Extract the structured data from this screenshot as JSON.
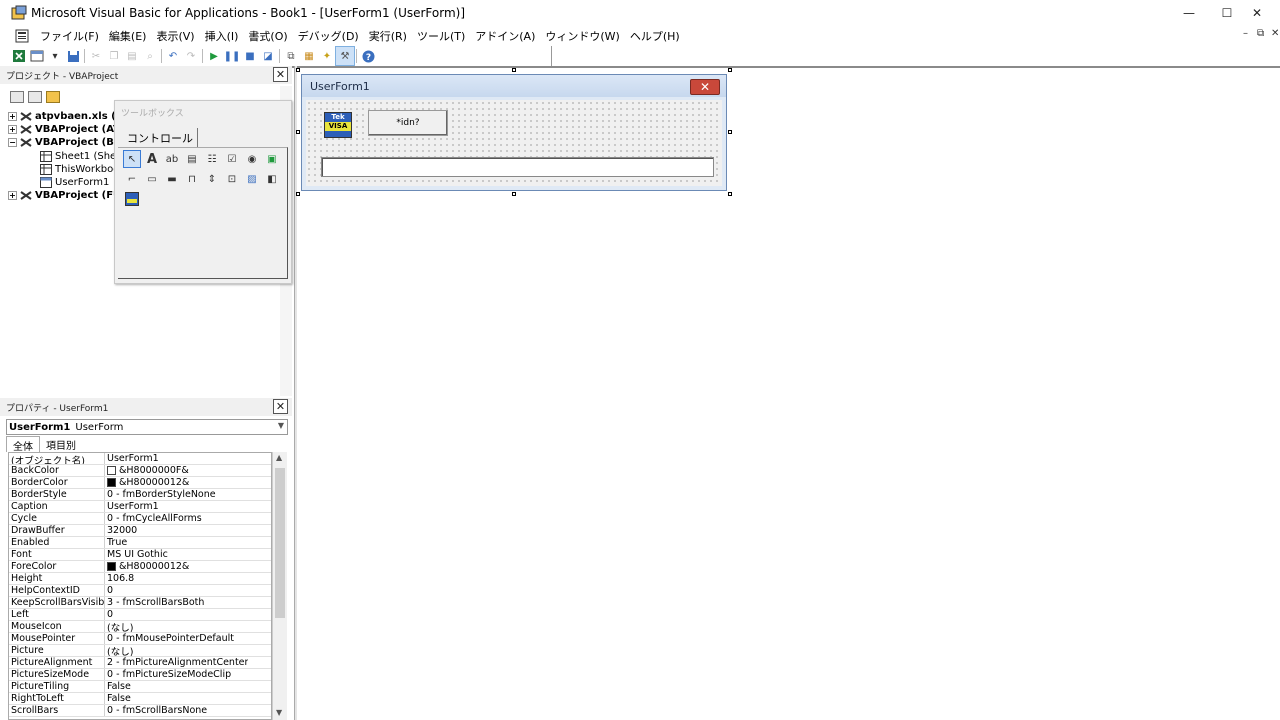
{
  "window": {
    "title": "Microsoft Visual Basic for Applications - Book1 - [UserForm1 (UserForm)]",
    "minimize_glyph": "—",
    "maximize_glyph": "☐",
    "close_glyph": "✕"
  },
  "menu": {
    "items": [
      "ファイル(F)",
      "編集(E)",
      "表示(V)",
      "挿入(I)",
      "書式(O)",
      "デバッグ(D)",
      "実行(R)",
      "ツール(T)",
      "アドイン(A)",
      "ウィンドウ(W)",
      "ヘルプ(H)"
    ],
    "mdi_minimize": "–",
    "mdi_restore": "⧉",
    "mdi_close": "✕"
  },
  "project": {
    "title": "プロジェクト - VBAProject",
    "tree": [
      {
        "label": "atpvbaen.xls (A",
        "expander": "+",
        "bold": true
      },
      {
        "label": "VBAProject (AT",
        "expander": "+",
        "bold": true
      },
      {
        "label": "VBAProject (Bo",
        "expander": "−",
        "bold": true
      },
      {
        "label": "Sheet1 (Shee",
        "expander": "",
        "bold": false
      },
      {
        "label": "ThisWorkbook",
        "expander": "",
        "bold": false
      },
      {
        "label": "UserForm1",
        "expander": "",
        "bold": false
      },
      {
        "label": "VBAProject (FU",
        "expander": "+",
        "bold": true
      }
    ]
  },
  "toolbox": {
    "title": "ツールボックス",
    "tab": "コントロール"
  },
  "properties": {
    "title": "プロパティ - UserForm1",
    "object_name": "UserForm1",
    "object_type": "UserForm",
    "tabs": [
      "全体",
      "項目別"
    ],
    "rows": [
      {
        "key": "(オブジェクト名)",
        "value": "UserForm1"
      },
      {
        "key": "BackColor",
        "value": "&H8000000F&",
        "swatch": "#ffffff"
      },
      {
        "key": "BorderColor",
        "value": "&H80000012&",
        "swatch": "#000000"
      },
      {
        "key": "BorderStyle",
        "value": "0 - fmBorderStyleNone"
      },
      {
        "key": "Caption",
        "value": "UserForm1"
      },
      {
        "key": "Cycle",
        "value": "0 - fmCycleAllForms"
      },
      {
        "key": "DrawBuffer",
        "value": "32000"
      },
      {
        "key": "Enabled",
        "value": "True"
      },
      {
        "key": "Font",
        "value": "MS UI Gothic"
      },
      {
        "key": "ForeColor",
        "value": "&H80000012&",
        "swatch": "#000000"
      },
      {
        "key": "Height",
        "value": "106.8"
      },
      {
        "key": "HelpContextID",
        "value": "0"
      },
      {
        "key": "KeepScrollBarsVisible",
        "value": "3 - fmScrollBarsBoth"
      },
      {
        "key": "Left",
        "value": "0"
      },
      {
        "key": "MouseIcon",
        "value": "(なし)"
      },
      {
        "key": "MousePointer",
        "value": "0 - fmMousePointerDefault"
      },
      {
        "key": "Picture",
        "value": "(なし)"
      },
      {
        "key": "PictureAlignment",
        "value": "2 - fmPictureAlignmentCenter"
      },
      {
        "key": "PictureSizeMode",
        "value": "0 - fmPictureSizeModeClip"
      },
      {
        "key": "PictureTiling",
        "value": "False"
      },
      {
        "key": "RightToLeft",
        "value": "False"
      },
      {
        "key": "ScrollBars",
        "value": "0 - fmScrollBarsNone"
      }
    ]
  },
  "userform": {
    "caption": "UserForm1",
    "close_glyph": "✕",
    "visa_icon_text1": "Tek",
    "visa_icon_text2": "VISA",
    "button_caption": "*idn?"
  },
  "colors": {
    "selection": "#cde1f7",
    "form_close": "#c9483a"
  }
}
